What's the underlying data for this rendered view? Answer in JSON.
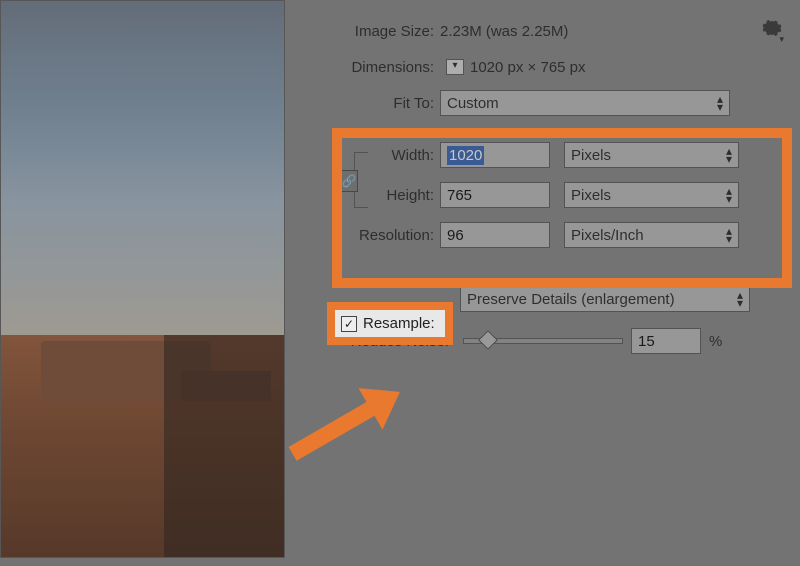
{
  "header": {
    "image_size_label": "Image Size:",
    "image_size_value": "2.23M (was 2.25M)",
    "dimensions_label": "Dimensions:",
    "dimensions_value": "1020 px  ×  765 px",
    "fit_to_label": "Fit To:",
    "fit_to_value": "Custom"
  },
  "size": {
    "width_label": "Width:",
    "width_value": "1020",
    "width_unit": "Pixels",
    "height_label": "Height:",
    "height_value": "765",
    "height_unit": "Pixels",
    "resolution_label": "Resolution:",
    "resolution_value": "96",
    "resolution_unit": "Pixels/Inch"
  },
  "resample": {
    "label": "Resample:",
    "checked": true,
    "method": "Preserve Details (enlargement)"
  },
  "noise": {
    "label": "Reduce Noise:",
    "value": "15",
    "percent": 15,
    "suffix": "%"
  },
  "icons": {
    "gear": "✱",
    "dropdown": "▾",
    "updown": "⇕",
    "check": "✓",
    "link": "⦀"
  },
  "colors": {
    "highlight": "#E8792E"
  }
}
